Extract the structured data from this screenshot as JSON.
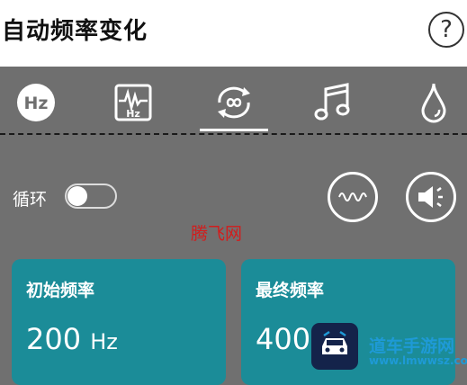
{
  "header": {
    "title": "自动频率变化",
    "help_label": "?"
  },
  "tabs": [
    {
      "name": "hz",
      "icon": "hz-circle-icon",
      "label": "Hz"
    },
    {
      "name": "waveform",
      "icon": "waveform-hz-icon",
      "label": "Hz"
    },
    {
      "name": "loop",
      "icon": "infinity-loop-icon",
      "selected": true
    },
    {
      "name": "music",
      "icon": "music-note-icon"
    },
    {
      "name": "drop",
      "icon": "water-drop-icon"
    }
  ],
  "controls": {
    "loop_label": "循环",
    "loop_enabled": false,
    "wave_button_icon": "sine-wave-icon",
    "volume_button_icon": "speaker-icon"
  },
  "cards": [
    {
      "title": "初始频率",
      "value": "200",
      "unit": "Hz"
    },
    {
      "title": "最终频率",
      "value": "400",
      "unit": ""
    }
  ],
  "watermarks": {
    "center": "腾飞网",
    "brand_name": "道车手游网",
    "brand_url": "www.lmwwsz.com"
  },
  "colors": {
    "background": "#707070",
    "card": "#1b8c98",
    "header": "#ffffff"
  }
}
